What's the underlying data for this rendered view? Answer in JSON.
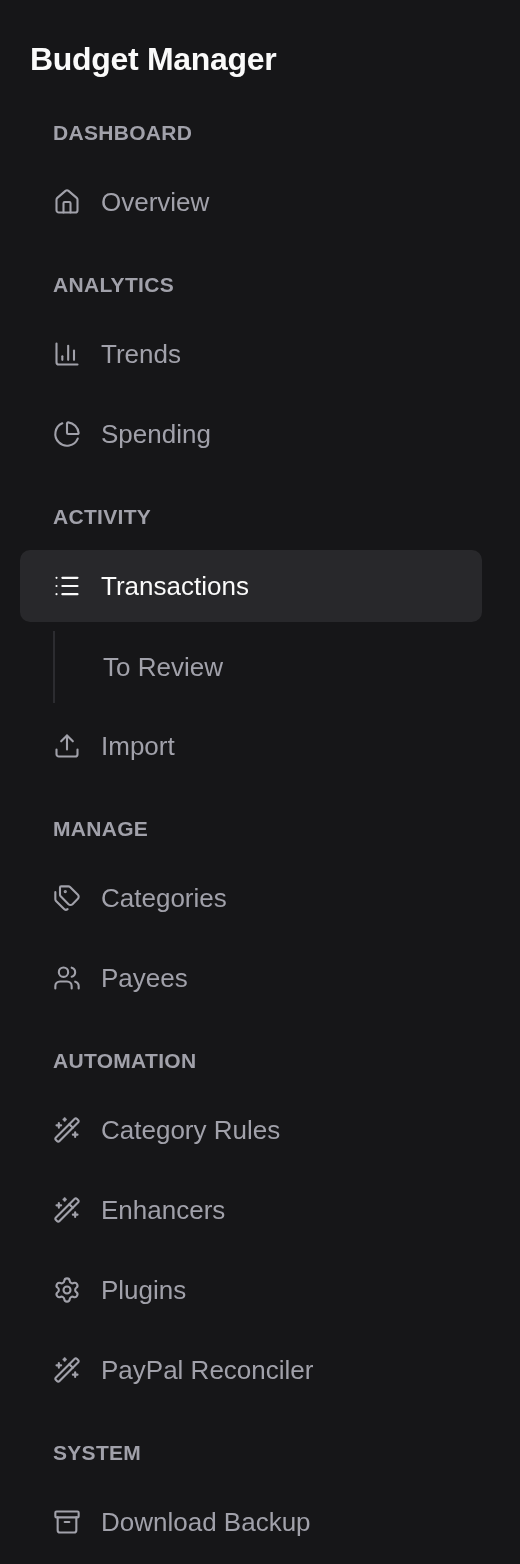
{
  "app_title": "Budget Manager",
  "sections": [
    {
      "heading": "DASHBOARD",
      "items": [
        {
          "label": "Overview",
          "selected": false
        }
      ]
    },
    {
      "heading": "ANALYTICS",
      "items": [
        {
          "label": "Trends",
          "selected": false
        },
        {
          "label": "Spending",
          "selected": false
        }
      ]
    },
    {
      "heading": "ACTIVITY",
      "items": [
        {
          "label": "Transactions",
          "selected": true,
          "children": [
            {
              "label": "To Review",
              "selected": false
            }
          ]
        },
        {
          "label": "Import",
          "selected": false
        }
      ]
    },
    {
      "heading": "MANAGE",
      "items": [
        {
          "label": "Categories",
          "selected": false
        },
        {
          "label": "Payees",
          "selected": false
        }
      ]
    },
    {
      "heading": "AUTOMATION",
      "items": [
        {
          "label": "Category Rules",
          "selected": false
        },
        {
          "label": "Enhancers",
          "selected": false
        },
        {
          "label": "Plugins",
          "selected": false
        },
        {
          "label": "PayPal Reconciler",
          "selected": false
        }
      ]
    },
    {
      "heading": "SYSTEM",
      "items": [
        {
          "label": "Download Backup",
          "selected": false
        }
      ]
    }
  ]
}
